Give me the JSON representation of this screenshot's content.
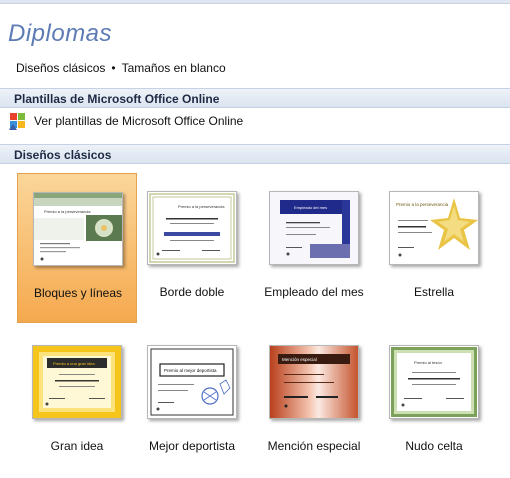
{
  "header": {
    "title": "Diplomas"
  },
  "breadcrumbs": {
    "item1": "Diseños clásicos",
    "separator": "•",
    "item2": "Tamaños en blanco"
  },
  "sections": {
    "online": {
      "heading": "Plantillas de Microsoft Office Online",
      "link": "Ver plantillas de Microsoft Office Online"
    },
    "classic": {
      "heading": "Diseños clásicos"
    }
  },
  "templates": [
    {
      "label": "Bloques y líneas",
      "selected": true
    },
    {
      "label": "Borde doble",
      "selected": false
    },
    {
      "label": "Empleado del mes",
      "selected": false
    },
    {
      "label": "Estrella",
      "selected": false
    },
    {
      "label": "Gran idea",
      "selected": false
    },
    {
      "label": "Mejor deportista",
      "selected": false
    },
    {
      "label": "Mención especial",
      "selected": false
    },
    {
      "label": "Nudo celta",
      "selected": false
    }
  ],
  "thumb_text": {
    "t1": "Premio a la perseverancia",
    "t2": "Premio a la perseverancia",
    "t3": "Empleado del mes",
    "t4": "Premio a la perseverancia",
    "t5": "Premio a una gran idea",
    "t6": "Premio al mejor deportista",
    "t7": "Mención especial",
    "t8": "Premio al tesón"
  },
  "colors": {
    "accent": "#5d7cb5",
    "selected_top": "#fbd69a",
    "selected_bottom": "#f5a94e"
  }
}
